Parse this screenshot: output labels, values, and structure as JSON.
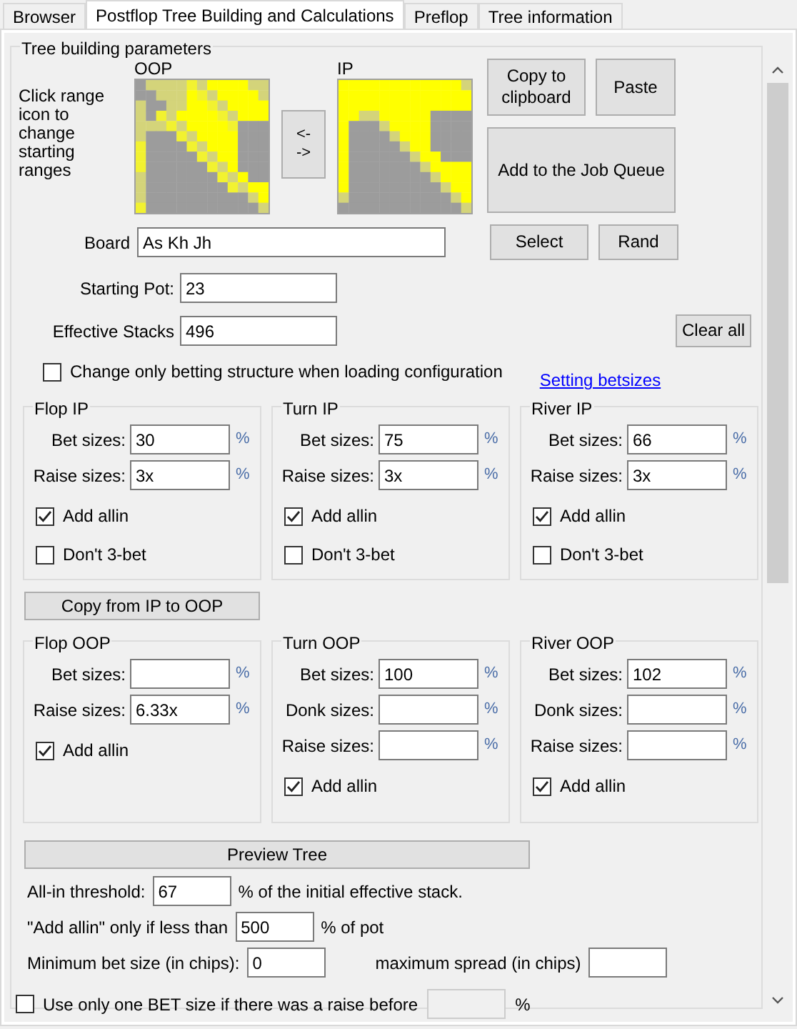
{
  "tabs": [
    {
      "label": "Browser",
      "selected": false
    },
    {
      "label": "Postflop Tree Building and Calculations",
      "selected": true
    },
    {
      "label": "Preflop",
      "selected": false
    },
    {
      "label": "Tree information",
      "selected": false
    }
  ],
  "group_title": "Tree building parameters",
  "ranges": {
    "instruction": "Click range icon to change starting ranges",
    "oop_label": "OOP",
    "ip_label": "IP",
    "swap_lines": [
      "<-",
      "->"
    ]
  },
  "buttons": {
    "copy": "Copy to clipboard",
    "paste": "Paste",
    "add_queue": "Add to the Job Queue",
    "select": "Select",
    "rand": "Rand",
    "clear_all": "Clear all",
    "copy_ip_oop": "Copy from IP to OOP",
    "preview": "Preview Tree"
  },
  "board": {
    "label": "Board",
    "value": "As Kh Jh"
  },
  "starting_pot": {
    "label": "Starting Pot:",
    "value": "23"
  },
  "effective_stacks": {
    "label": "Effective Stacks",
    "value": "496"
  },
  "change_only_betting": {
    "label": "Change only betting structure when loading configuration",
    "checked": false
  },
  "link": "Setting betsizes",
  "streets": [
    {
      "title": "Flop IP",
      "fields": [
        {
          "label": "Bet sizes:",
          "value": "30",
          "unit": "%"
        },
        {
          "label": "Raise sizes:",
          "value": "3x",
          "unit": "%"
        }
      ],
      "checks": [
        {
          "label": "Add allin",
          "checked": true
        },
        {
          "label": "Don't 3-bet",
          "checked": false
        }
      ]
    },
    {
      "title": "Turn IP",
      "fields": [
        {
          "label": "Bet sizes:",
          "value": "75",
          "unit": "%"
        },
        {
          "label": "Raise sizes:",
          "value": "3x",
          "unit": "%"
        }
      ],
      "checks": [
        {
          "label": "Add allin",
          "checked": true
        },
        {
          "label": "Don't 3-bet",
          "checked": false
        }
      ]
    },
    {
      "title": "River IP",
      "fields": [
        {
          "label": "Bet sizes:",
          "value": "66",
          "unit": "%"
        },
        {
          "label": "Raise sizes:",
          "value": "3x",
          "unit": "%"
        }
      ],
      "checks": [
        {
          "label": "Add allin",
          "checked": true
        },
        {
          "label": "Don't 3-bet",
          "checked": false
        }
      ]
    },
    {
      "title": "Flop OOP",
      "fields": [
        {
          "label": "Bet sizes:",
          "unit": "%"
        },
        {
          "label": "Raise sizes:",
          "value": "6.33x",
          "unit": "%"
        }
      ],
      "checks": [
        {
          "label": "Add allin",
          "checked": true
        }
      ]
    },
    {
      "title": "Turn OOP",
      "fields": [
        {
          "label": "Bet sizes:",
          "value": "100",
          "unit": "%"
        },
        {
          "label": "Donk sizes:",
          "unit": "%"
        },
        {
          "label": "Raise sizes:",
          "unit": "%"
        }
      ],
      "checks": [
        {
          "label": "Add allin",
          "checked": true
        }
      ]
    },
    {
      "title": "River OOP",
      "fields": [
        {
          "label": "Bet sizes:",
          "value": "102",
          "unit": "%"
        },
        {
          "label": "Donk sizes:",
          "unit": "%"
        },
        {
          "label": "Raise sizes:",
          "unit": "%"
        }
      ],
      "checks": [
        {
          "label": "Add allin",
          "checked": true
        }
      ]
    }
  ],
  "all_in_threshold": {
    "label": "All-in threshold:",
    "value": "67",
    "suffix": "% of the initial effective stack."
  },
  "add_allin_only": {
    "label": "\"Add allin\" only if less than",
    "value": "500",
    "suffix": "% of pot"
  },
  "min_bet": {
    "label": "Minimum bet size (in chips):",
    "value": "0"
  },
  "max_spread": {
    "label": "maximum spread (in chips)"
  },
  "one_bet": {
    "label": "Use only one BET size if there was a raise before",
    "checked": false,
    "field_disabled": true,
    "unit": "%"
  }
}
